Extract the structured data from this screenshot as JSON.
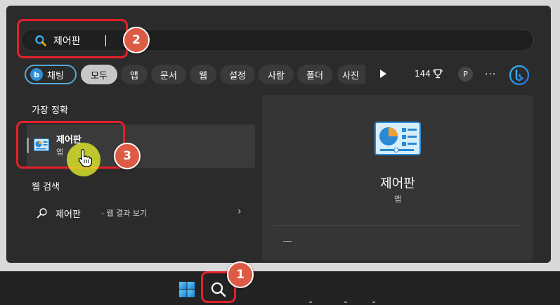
{
  "search": {
    "query": "제어판"
  },
  "filters": {
    "bing_chat": "채팅",
    "items": [
      "모두",
      "앱",
      "문서",
      "웹",
      "설정",
      "사람",
      "폴더",
      "사진"
    ],
    "active_index": 0
  },
  "header": {
    "points": "144",
    "avatar_initial": "P",
    "more": "···"
  },
  "best_match": {
    "section_title": "가장 정확",
    "title": "제어판",
    "subtitle": "앱"
  },
  "web": {
    "section_title": "웹 검색",
    "query": "제어판",
    "suffix": "- 웹 결과 보기",
    "chevron": "›"
  },
  "detail": {
    "title": "제어판",
    "subtitle": "앱"
  },
  "steps": [
    "1",
    "2",
    "3"
  ],
  "colors": {
    "panel": "#2b2b2b",
    "highlight": "#e5202a",
    "badge": "#dd5b45",
    "accent": "#56a8d8"
  }
}
